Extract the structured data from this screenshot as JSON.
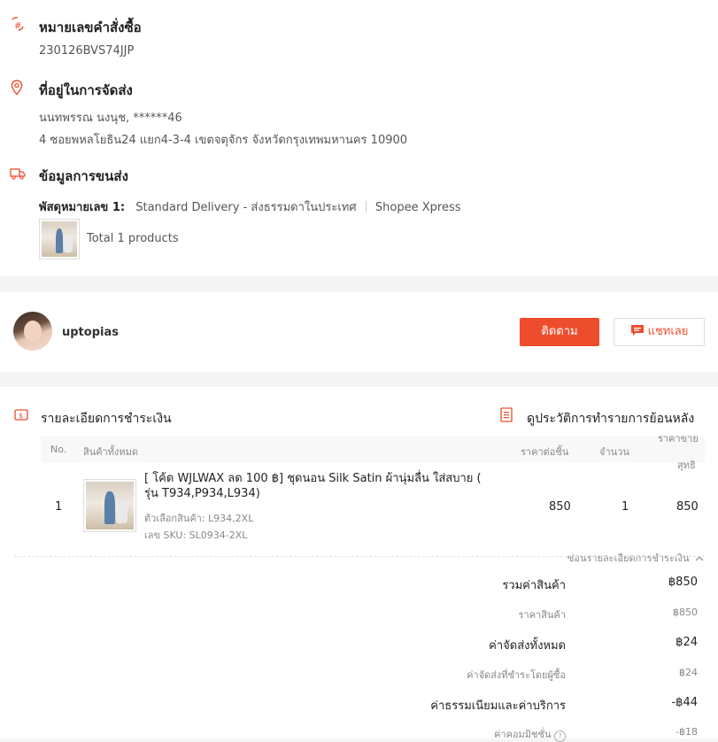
{
  "order": {
    "title": "หมายเลขคำสั่งซื้อ",
    "number": "230126BVS74JJP"
  },
  "address": {
    "title": "ที่อยู่ในการจัดส่ง",
    "name_line": "นนทพรรณ นงนุช, ******46",
    "line": "4 ซอยพหลโยธิน24 แยก4-3-4 เขตจตุจักร จังหวัดกรุงเทพมหานคร 10900"
  },
  "shipping": {
    "title": "ข้อมูลการขนส่ง",
    "parcel_label": "พัสดุหมายเลข 1:",
    "method": "Standard Delivery - ส่งธรรมดาในประเทศ",
    "carrier": "Shopee Xpress",
    "total_products": "Total 1 products"
  },
  "shop": {
    "name": "uptopias",
    "follow_label": "ติดตาม",
    "chat_label": "แชทเลย"
  },
  "payment": {
    "title": "รายละเอียดการชำระเงิน",
    "history_link": "ดูประวัติการทำรายการย้อนหลัง",
    "columns": {
      "no": "No.",
      "product": "สินค้าทั้งหมด",
      "unit_price": "ราคาต่อชิ้น",
      "qty": "จำนวน",
      "net_line1": "ราคาขาย",
      "net_line2": "สุทธิ"
    },
    "items": [
      {
        "no": "1",
        "name": "[ โค้ด WJLWAX ลด 100 ฿] ชุดนอน Silk Satin ผ้านุ่มลื่น ใส่สบาย ( รุ่น T934,P934,L934)",
        "variation": "ตัวเลือกสินค้า: L934,2XL",
        "sku": "เลข SKU: SL0934-2XL",
        "unit_price": "850",
        "qty": "1",
        "net": "850"
      }
    ],
    "hide_details": "ซ่อนรายละเอียดการชำระเงิน",
    "summary": [
      {
        "label": "รวมค่าสินค้า",
        "value": "฿850",
        "level": "main"
      },
      {
        "label": "ราคาสินค้า",
        "value": "฿850",
        "level": "sub"
      },
      {
        "label": "ค่าจัดส่งทั้งหมด",
        "value": "฿24",
        "level": "main"
      },
      {
        "label": "ค่าจัดส่งที่ชำระโดยผู้ซื้อ",
        "value": "฿24",
        "level": "sub"
      },
      {
        "label": "ค่าธรรมเนียมและค่าบริการ",
        "value": "-฿44",
        "level": "main"
      },
      {
        "label": "ค่าคอมมิชชั่น",
        "value": "-฿18",
        "level": "sub"
      }
    ]
  },
  "colors": {
    "accent": "#ee4d2d",
    "background": "#f5f5f5"
  },
  "icons": {
    "order": "order-hash-icon",
    "address": "location-pin-icon",
    "shipping": "truck-icon",
    "payment": "payment-icon",
    "history": "document-icon",
    "chat": "chat-icon",
    "help": "help-circle-icon",
    "chevron": "chevron-up-icon"
  }
}
